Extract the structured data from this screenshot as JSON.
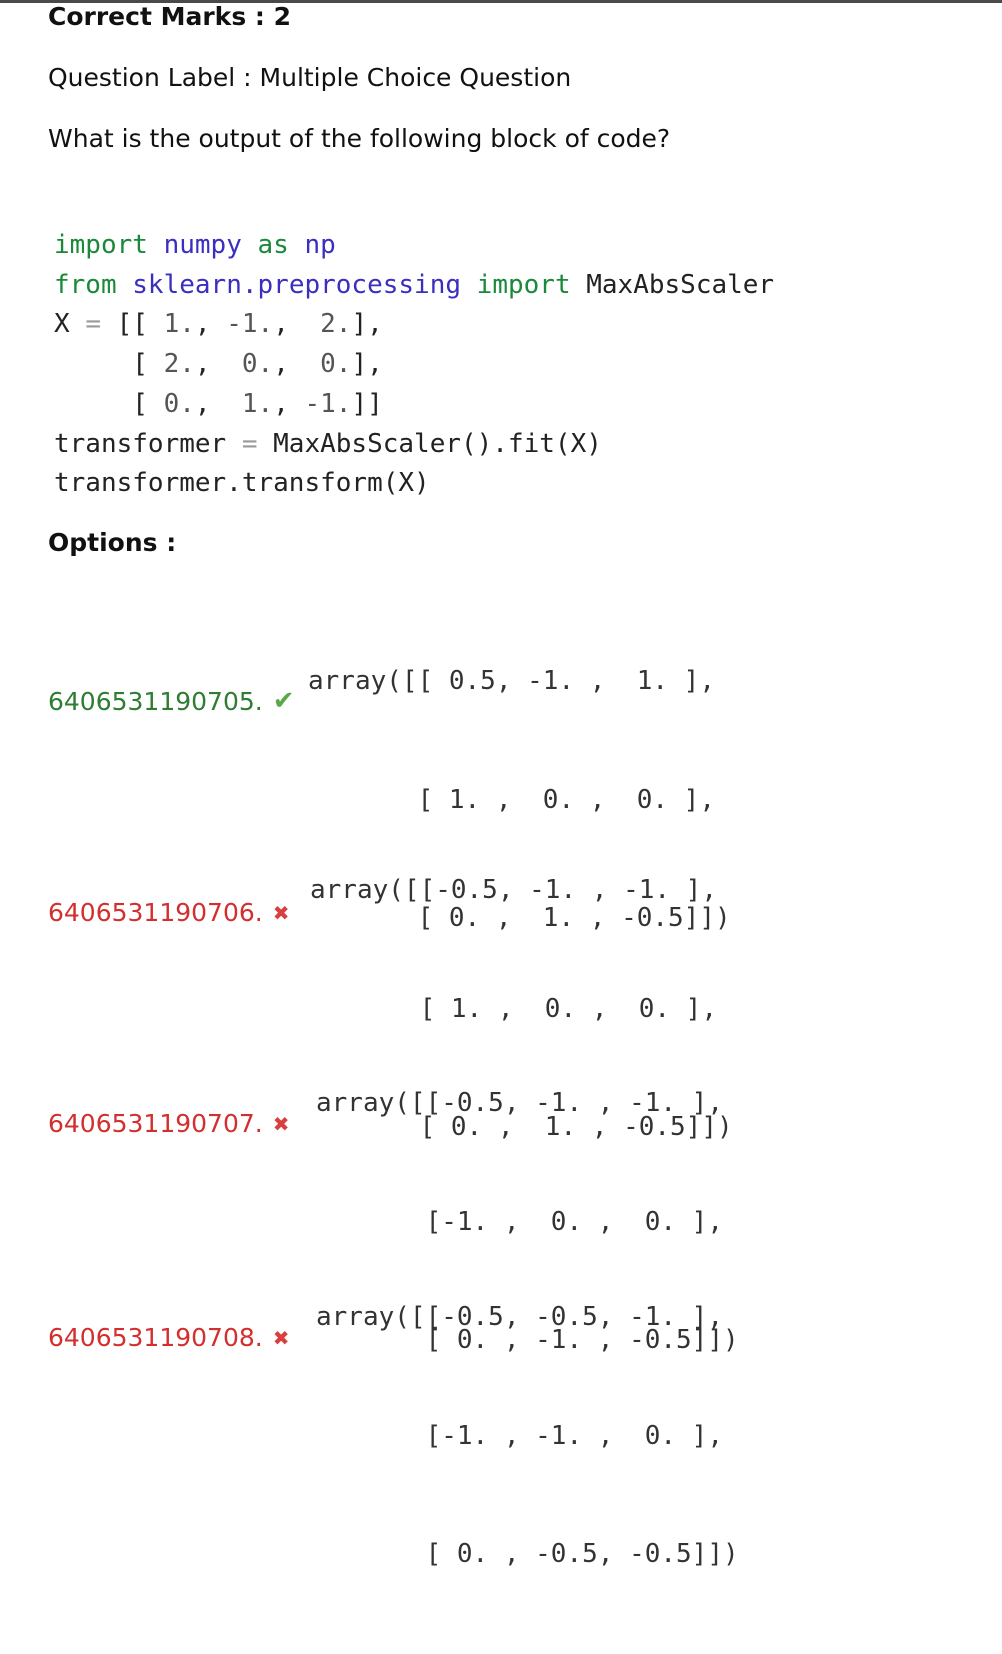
{
  "header": {
    "correct_marks": "Correct Marks : 2",
    "question_label": "Question Label : Multiple Choice Question",
    "question_text": "What is the output of the following block of code?"
  },
  "code": {
    "lines": [
      "import numpy as np",
      "from sklearn.preprocessing import MaxAbsScaler",
      "X = [[ 1., -1.,  2.],",
      "     [ 2.,  0.,  0.],",
      "     [ 0.,  1., -1.]]",
      "transformer = MaxAbsScaler().fit(X)",
      "transformer.transform(X)"
    ]
  },
  "options_heading": "Options :",
  "options": [
    {
      "id": "6406531190705.",
      "status": "correct",
      "icon": "check-icon",
      "array_lines": [
        "array([[ 0.5, -1. ,  1. ],",
        "       [ 1. ,  0. ,  0. ],",
        "       [ 0. ,  1. , -0.5]])"
      ]
    },
    {
      "id": "6406531190706.",
      "status": "wrong",
      "icon": "cross-icon",
      "array_lines": [
        "array([[-0.5, -1. , -1. ],",
        "       [ 1. ,  0. ,  0. ],",
        "       [ 0. ,  1. , -0.5]])"
      ]
    },
    {
      "id": "6406531190707.",
      "status": "wrong",
      "icon": "cross-icon",
      "array_lines": [
        "array([[-0.5, -1. , -1. ],",
        "       [-1. ,  0. ,  0. ],",
        "       [ 0. , -1. , -0.5]])"
      ]
    },
    {
      "id": "6406531190708.",
      "status": "wrong",
      "icon": "cross-icon",
      "array_lines": [
        "array([[-0.5, -0.5, -1. ],",
        "       [-1. , -1. ,  0. ],",
        "       [ 0. , -0.5, -0.5]])"
      ]
    }
  ],
  "colors": {
    "correct": "#2e7d32",
    "wrong": "#d32f2f",
    "keyword": "#1a8a3a",
    "module": "#3b2fc0"
  }
}
